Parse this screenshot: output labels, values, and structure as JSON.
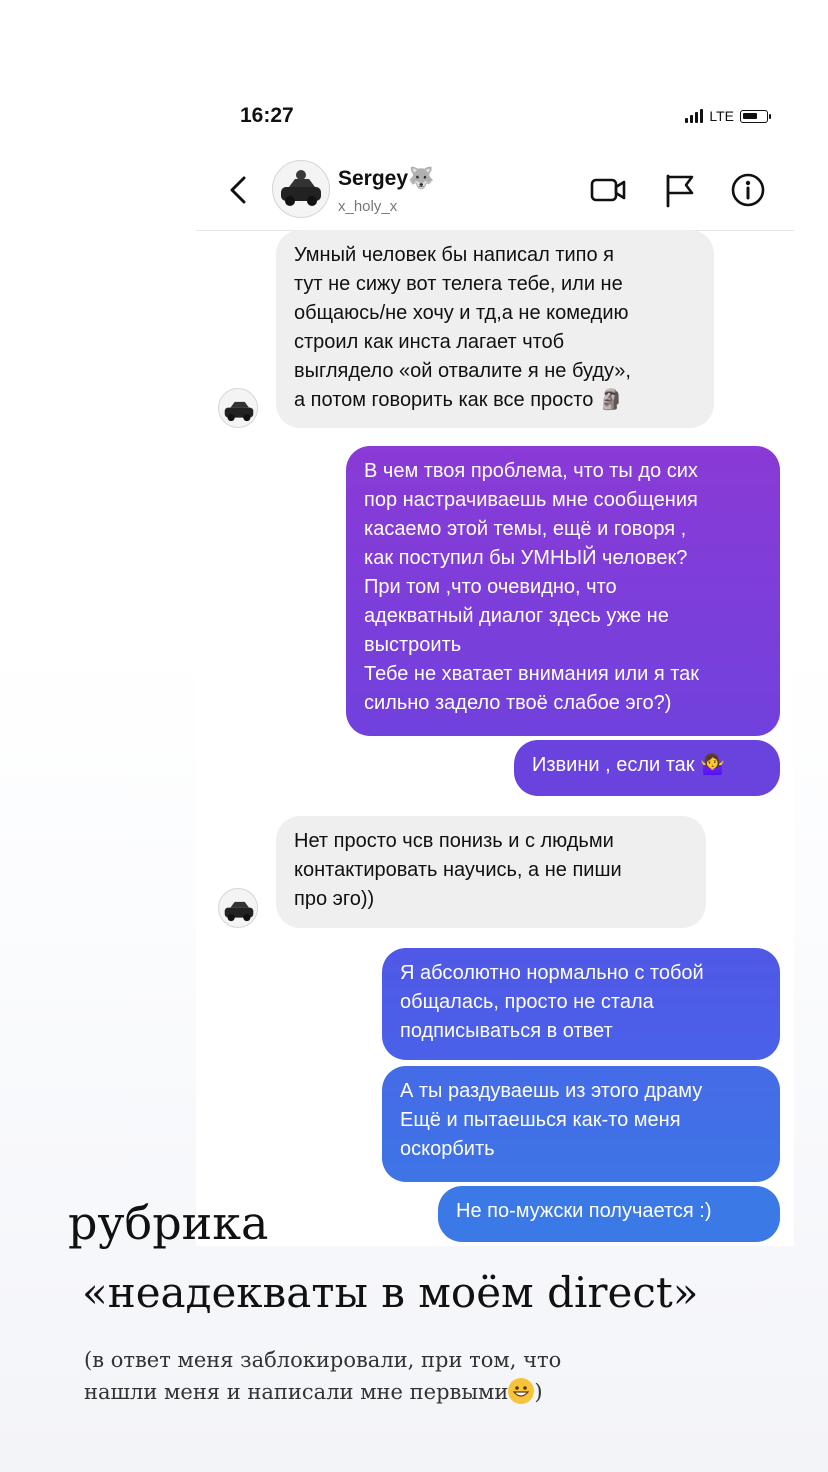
{
  "status_bar": {
    "time": "16:27",
    "network": "LTE"
  },
  "header": {
    "username": "Sergey🐺",
    "handle": "x_holy_x",
    "icons": [
      "back-chevron-icon",
      "video-call-icon",
      "report-flag-icon",
      "info-icon"
    ]
  },
  "messages": [
    {
      "side": "in",
      "lines": [
        "Умный человек бы написал типо я",
        "тут не сижу вот телега тебе, или не",
        "общаюсь/не хочу и тд,а не комедию",
        "строил как инста лагает чтоб",
        "выглядело «ой отвалите я не буду»,",
        "а потом говорить как все просто 🗿"
      ]
    },
    {
      "side": "out",
      "lines": [
        "В чем твоя проблема, что ты до сих",
        "пор настрачиваешь мне сообщения",
        "касаемо этой темы, ещё и говоря ,",
        "как поступил бы УМНЫЙ человек?",
        "При том ,что очевидно, что",
        "адекватный диалог здесь уже не",
        "выстроить",
        "Тебе не хватает внимания или я так",
        "сильно задело твоё слабое эго?)"
      ]
    },
    {
      "side": "out",
      "lines": [
        "Извини , если так 🤷‍♀️"
      ]
    },
    {
      "side": "in",
      "lines": [
        "Нет просто чсв понизь и с людьми",
        "контактировать научись, а не пиши",
        "про эго))"
      ]
    },
    {
      "side": "out",
      "lines": [
        "Я абсолютно нормально с тобой",
        "общалась, просто не стала",
        "подписываться в ответ"
      ]
    },
    {
      "side": "out",
      "lines": [
        "А ты раздуваешь из этого драму",
        "Ещё и пытаешься как-то меня",
        "оскорбить"
      ]
    },
    {
      "side": "out",
      "lines": [
        "Не по-мужски получается :)"
      ]
    }
  ],
  "caption": {
    "title_line1": "рубрика",
    "title_line2": "«неадекваты в моём direct»",
    "subtitle_line1": "(в ответ меня заблокировали, при том, что",
    "subtitle_line2": "нашли меня и написали мне первыми",
    "subtitle_end": ")"
  },
  "colors": {
    "incoming_bubble": "#efefef",
    "outgoing_gradient": [
      "#8a3ad6",
      "#6f3fe0",
      "#4f5ae6",
      "#3d76e6"
    ]
  }
}
